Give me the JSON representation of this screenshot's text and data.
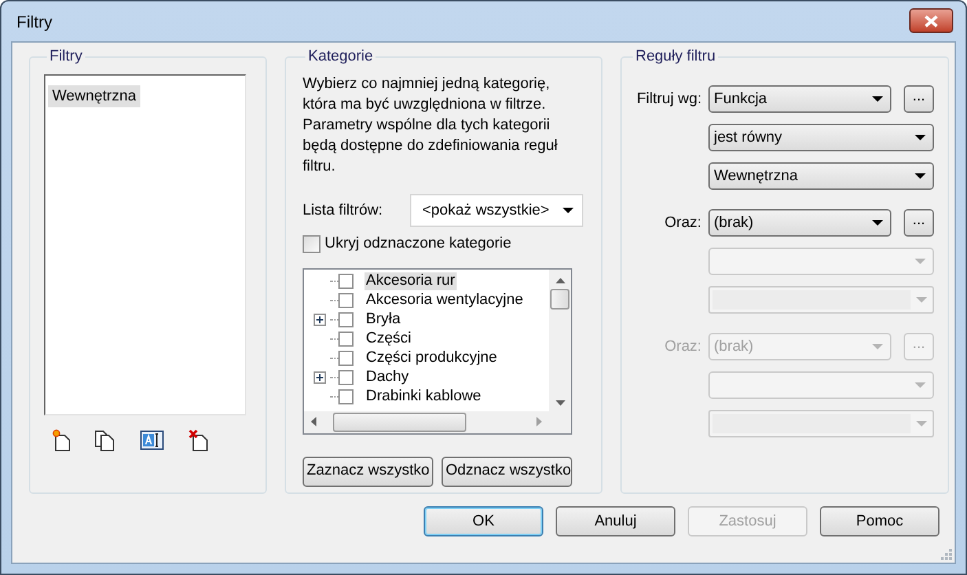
{
  "window": {
    "title": "Filtry"
  },
  "filters": {
    "title": "Filtry",
    "items": [
      {
        "label": "Wewnętrzna",
        "selected": true
      }
    ]
  },
  "categories": {
    "title": "Kategorie",
    "description": "Wybierz co najmniej jedną kategorię, która ma być uwzględniona w filtrze. Parametry wspólne dla tych kategorii będą dostępne do zdefiniowania reguł filtru.",
    "filter_list": {
      "label": "Lista filtrów:",
      "value": "<pokaż wszystkie>"
    },
    "hide_checked": {
      "label": "Ukryj odznaczone kategorie",
      "checked": false
    },
    "tree": [
      {
        "label": "Akcesoria rur",
        "checked": false,
        "expandable": false,
        "selected": true
      },
      {
        "label": "Akcesoria wentylacyjne",
        "checked": false,
        "expandable": false,
        "selected": false
      },
      {
        "label": "Bryła",
        "checked": false,
        "expandable": true,
        "selected": false
      },
      {
        "label": "Części",
        "checked": false,
        "expandable": false,
        "selected": false
      },
      {
        "label": "Części produkcyjne",
        "checked": false,
        "expandable": false,
        "selected": false
      },
      {
        "label": "Dachy",
        "checked": false,
        "expandable": true,
        "selected": false
      },
      {
        "label": "Drabinki kablowe",
        "checked": false,
        "expandable": false,
        "selected": false
      }
    ],
    "buttons": [
      "Zaznacz wszystko",
      "Odznacz wszystko"
    ]
  },
  "rules": {
    "title": "Reguły filtru",
    "groups": [
      {
        "label": "Filtruj wg:",
        "disabled": false,
        "fields": [
          {
            "kind": "dropdown",
            "value": "Funkcja",
            "disabled": false
          },
          {
            "kind": "dropdown",
            "value": "jest równy",
            "disabled": false
          },
          {
            "kind": "dropdown",
            "value": "Wewnętrzna",
            "disabled": false
          }
        ],
        "more": {
          "label": "...",
          "disabled": false
        }
      },
      {
        "label": "Oraz:",
        "disabled": false,
        "fields": [
          {
            "kind": "dropdown",
            "value": "(brak)",
            "disabled": false
          },
          {
            "kind": "dropdown",
            "disabled": true
          },
          {
            "kind": "editable",
            "disabled": true
          }
        ],
        "more": {
          "label": "...",
          "disabled": false
        }
      },
      {
        "label": "Oraz:",
        "disabled": true,
        "fields": [
          {
            "kind": "dropdown",
            "value": "(brak)",
            "disabled": true
          },
          {
            "kind": "dropdown",
            "disabled": true
          },
          {
            "kind": "editable",
            "disabled": true
          }
        ],
        "more": {
          "label": "...",
          "disabled": true
        }
      }
    ]
  },
  "buttons": [
    {
      "label": "OK",
      "default": true,
      "disabled": false
    },
    {
      "label": "Anuluj",
      "default": false,
      "disabled": false
    },
    {
      "label": "Zastosuj",
      "default": false,
      "disabled": true
    },
    {
      "label": "Pomoc",
      "default": false,
      "disabled": false
    }
  ]
}
